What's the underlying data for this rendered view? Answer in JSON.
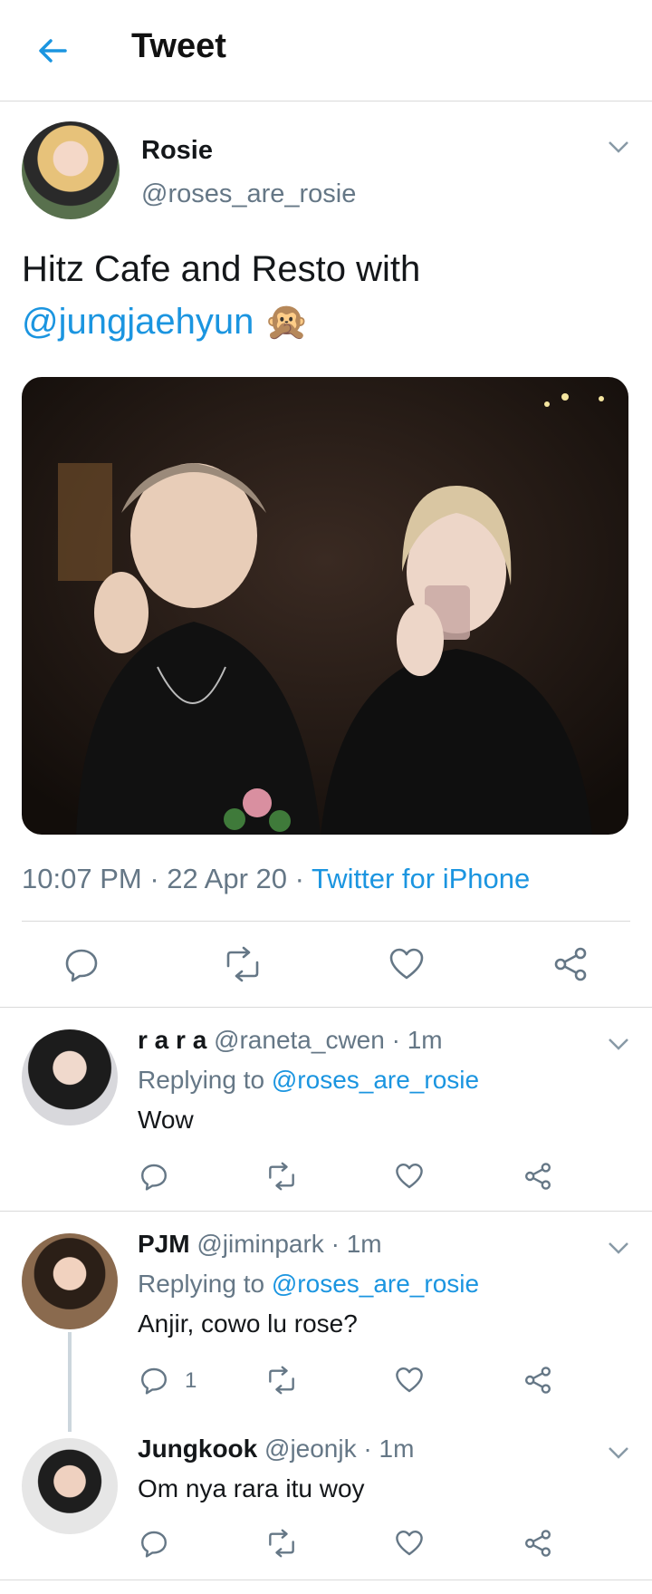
{
  "header": {
    "title": "Tweet",
    "back_icon": "back-arrow-icon"
  },
  "tweet": {
    "display_name": "Rosie",
    "handle": "@roses_are_rosie",
    "text_plain": "Hitz Cafe and Resto with",
    "mention": "@jungjaehyun",
    "emoji": "🙊",
    "time": "10:07 PM",
    "date": "22 Apr 20",
    "dot": "·",
    "source": "Twitter for iPhone",
    "photo_alt": "Photo"
  },
  "replies": [
    {
      "display_name": "r a r a",
      "handle": "@raneta_cwen",
      "time": "1m",
      "replying_prefix": "Replying to",
      "replying_to": "@roses_are_rosie",
      "text": "Wow",
      "reply_count": ""
    },
    {
      "display_name": "PJM",
      "handle": "@jiminpark",
      "time": "1m",
      "replying_prefix": "Replying to",
      "replying_to": "@roses_are_rosie",
      "text": "Anjir, cowo lu rose?",
      "reply_count": "1"
    },
    {
      "display_name": "Jungkook",
      "handle": "@jeonjk",
      "time": "1m",
      "text": "Om nya rara itu woy",
      "reply_count": ""
    }
  ],
  "colors": {
    "accent": "#1b95e0",
    "text": "#14171a",
    "muted": "#657786",
    "divider": "#d9d9d9"
  }
}
